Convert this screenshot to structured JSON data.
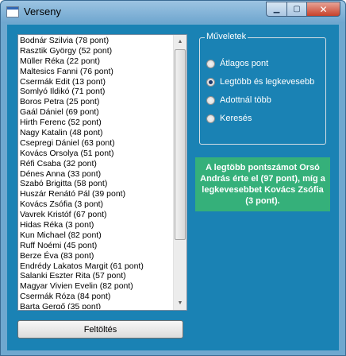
{
  "window": {
    "title": "Verseny"
  },
  "list": {
    "items": [
      "Bodnár Szilvia (78 pont)",
      "Rasztik György (52 pont)",
      "Müller Réka (22 pont)",
      "Maltesics Fanni (76 pont)",
      "Csermák Edit (13 pont)",
      "Somlyó Ildikó (71 pont)",
      "Boros Petra (25 pont)",
      "Gaál Dániel (69 pont)",
      "Hirth Ferenc (52 pont)",
      "Nagy Katalin (48 pont)",
      "Csepregi Dániel (63 pont)",
      "Kovács Orsolya (51 pont)",
      "Réfi Csaba (32 pont)",
      "Dénes Anna (33 pont)",
      "Szabó Brigitta (58 pont)",
      "Huszár Renátó Pál (39 pont)",
      "Kovács Zsófia (3 pont)",
      "Vavrek Kristóf (67 pont)",
      "Hidas Réka (3 pont)",
      "Kun Michael (82 pont)",
      "Ruff Noémi (45 pont)",
      "Berze Éva (83 pont)",
      "Endrédy Lakatos Margit (61 pont)",
      "Salanki Eszter Rita (57 pont)",
      "Magyar Vivien Evelin (82 pont)",
      "Csermák Róza (84 pont)",
      "Barta Gergő (35 pont)"
    ]
  },
  "buttons": {
    "upload_label": "Feltöltés"
  },
  "operations": {
    "legend": "Műveletek",
    "options": [
      {
        "label": "Átlagos pont",
        "checked": false
      },
      {
        "label": "Legtöbb és legkevesebb",
        "checked": true
      },
      {
        "label": "Adottnál több",
        "checked": false
      },
      {
        "label": "Keresés",
        "checked": false
      }
    ]
  },
  "result": {
    "text": "A legtöbb pontszámot Orsó András érte el (97 pont), míg a legkevesebbet Kovács Zsófia (3 pont)."
  },
  "colors": {
    "client_background": "#1a82b4",
    "result_background": "#35b07a"
  },
  "icons": {
    "app": "window-form-icon",
    "minimize": "minimize-icon",
    "maximize": "maximize-icon",
    "close": "close-icon",
    "scroll_up": "chevron-up-icon",
    "scroll_down": "chevron-down-icon"
  }
}
